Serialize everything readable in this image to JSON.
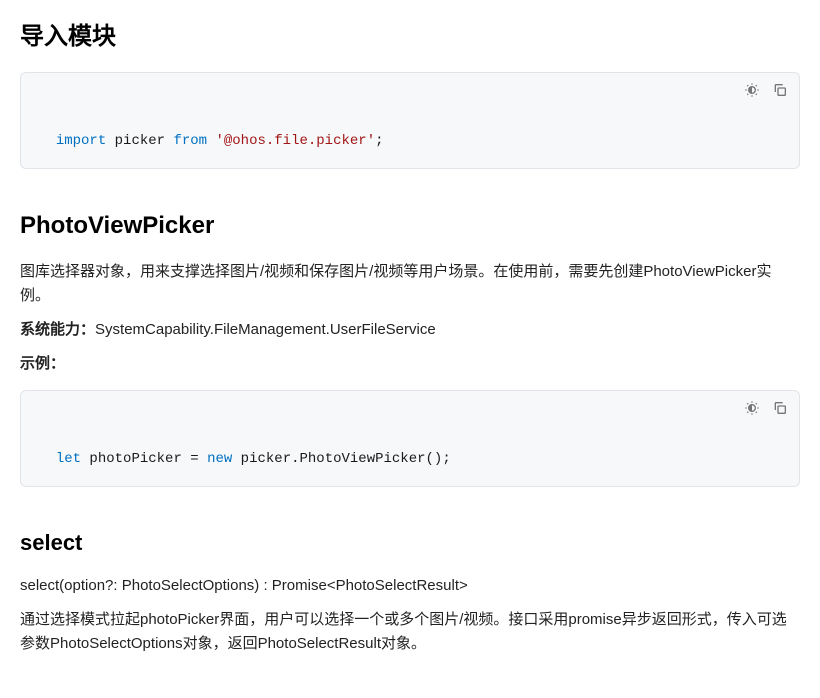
{
  "section_import": {
    "heading": "导入模块",
    "code": {
      "tokens": {
        "import": "import",
        "identifier": " picker ",
        "from": "from",
        "sp": " ",
        "string": "'@ohos.file.picker'",
        "semi": ";"
      }
    }
  },
  "section_photoviewpicker": {
    "heading": "PhotoViewPicker",
    "desc": "图库选择器对象，用来支撑选择图片/视频和保存图片/视频等用户场景。在使用前，需要先创建PhotoViewPicker实例。",
    "syscap_label": "系统能力：",
    "syscap_value": "SystemCapability.FileManagement.UserFileService",
    "example_label": "示例：",
    "code": {
      "tokens": {
        "let": "let",
        "decl": " photoPicker = ",
        "new": "new",
        "call": " picker.PhotoViewPicker();"
      }
    }
  },
  "section_select": {
    "heading": "select",
    "signature": "select(option?: PhotoSelectOptions) : Promise<PhotoSelectResult>",
    "desc": "通过选择模式拉起photoPicker界面，用户可以选择一个或多个图片/视频。接口采用promise异步返回形式，传入可选参数PhotoSelectOptions对象，返回PhotoSelectResult对象。"
  },
  "icons": {
    "theme": "theme-toggle-icon",
    "copy": "copy-icon"
  }
}
